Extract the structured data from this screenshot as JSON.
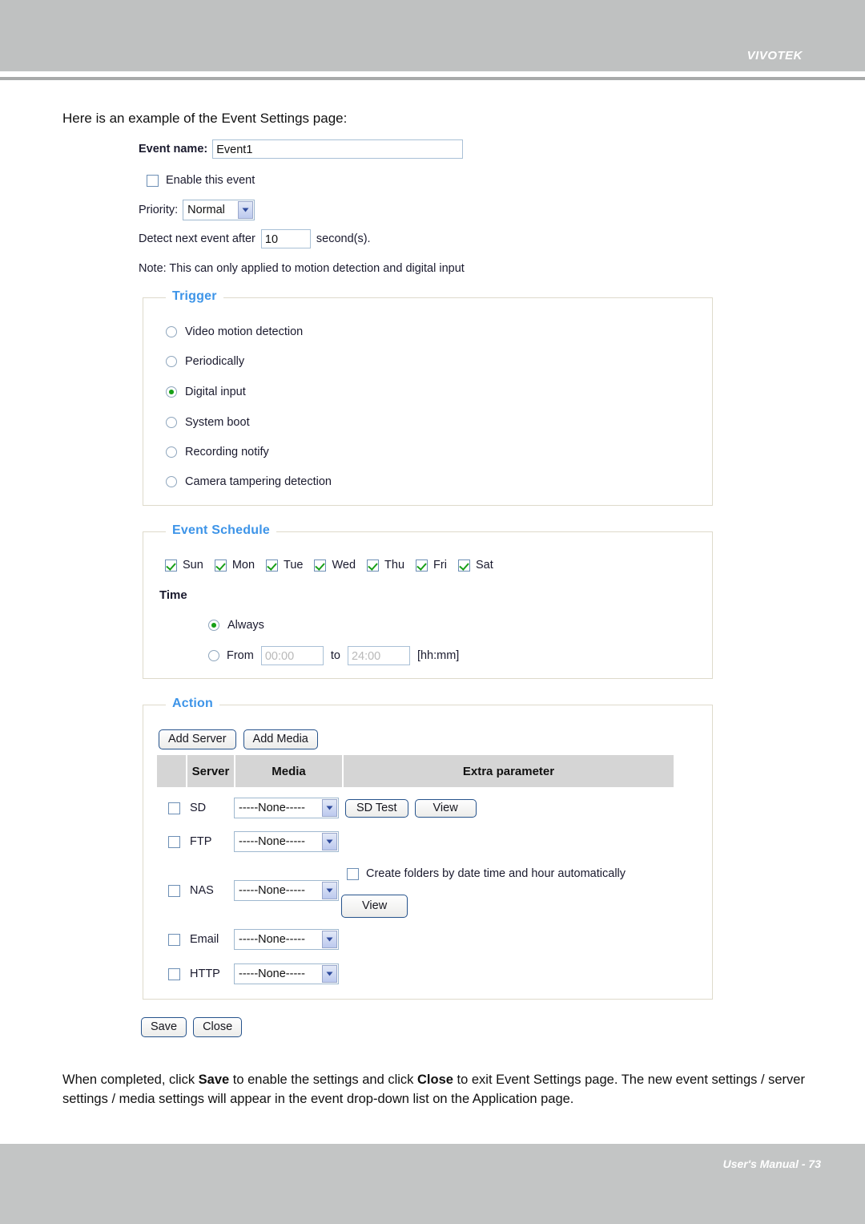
{
  "page": {
    "brand": "VIVOTEK",
    "footer": "User's Manual - 73",
    "intro": "Here is an example of the Event Settings page:",
    "outro_part1": "When completed, click ",
    "outro_save": "Save",
    "outro_part2": " to enable the settings and click ",
    "outro_close": "Close",
    "outro_part3": " to exit Event Settings page. The new event settings / server settings / media settings will appear in the event drop-down list on the Application page."
  },
  "form": {
    "event_name_label": "Event name:",
    "event_name_value": "Event1",
    "enable_event_label": "Enable this event",
    "enable_event_checked": false,
    "priority_label": "Priority:",
    "priority_value": "Normal",
    "detect_label": "Detect next event after",
    "detect_value": "10",
    "detect_suffix": "second(s).",
    "note": "Note: This can only applied to motion detection and digital input"
  },
  "trigger": {
    "legend": "Trigger",
    "selected": "Digital input",
    "options": [
      {
        "label": "Video motion detection",
        "checked": false
      },
      {
        "label": "Periodically",
        "checked": false
      },
      {
        "label": "Digital input",
        "checked": true
      },
      {
        "label": "System boot",
        "checked": false
      },
      {
        "label": "Recording notify",
        "checked": false
      },
      {
        "label": "Camera tampering detection",
        "checked": false
      }
    ]
  },
  "schedule": {
    "legend": "Event Schedule",
    "days": [
      {
        "label": "Sun",
        "checked": true
      },
      {
        "label": "Mon",
        "checked": true
      },
      {
        "label": "Tue",
        "checked": true
      },
      {
        "label": "Wed",
        "checked": true
      },
      {
        "label": "Thu",
        "checked": true
      },
      {
        "label": "Fri",
        "checked": true
      },
      {
        "label": "Sat",
        "checked": true
      }
    ],
    "time_label": "Time",
    "always_label": "Always",
    "always_selected": true,
    "from_label": "From",
    "from_placeholder": "00:00",
    "to_label": "to",
    "to_placeholder": "24:00",
    "format_hint": "[hh:mm]"
  },
  "action": {
    "legend": "Action",
    "add_server_label": "Add Server",
    "add_media_label": "Add Media",
    "columns": [
      "",
      "Server",
      "Media",
      "Extra parameter"
    ],
    "rows": [
      {
        "server": "SD",
        "checked": false,
        "media": "-----None-----",
        "extra_buttons": [
          "SD Test",
          "View"
        ]
      },
      {
        "server": "FTP",
        "checked": false,
        "media": "-----None-----",
        "extra_buttons": []
      },
      {
        "server": "NAS",
        "checked": false,
        "media": "-----None-----",
        "extra_checkbox_label": "Create folders by date time and hour automatically",
        "extra_checkbox_checked": false,
        "extra_buttons": [
          "View"
        ]
      },
      {
        "server": "Email",
        "checked": false,
        "media": "-----None-----",
        "extra_buttons": []
      },
      {
        "server": "HTTP",
        "checked": false,
        "media": "-----None-----",
        "extra_buttons": []
      }
    ]
  },
  "footer_buttons": {
    "save_label": "Save",
    "close_label": "Close"
  }
}
